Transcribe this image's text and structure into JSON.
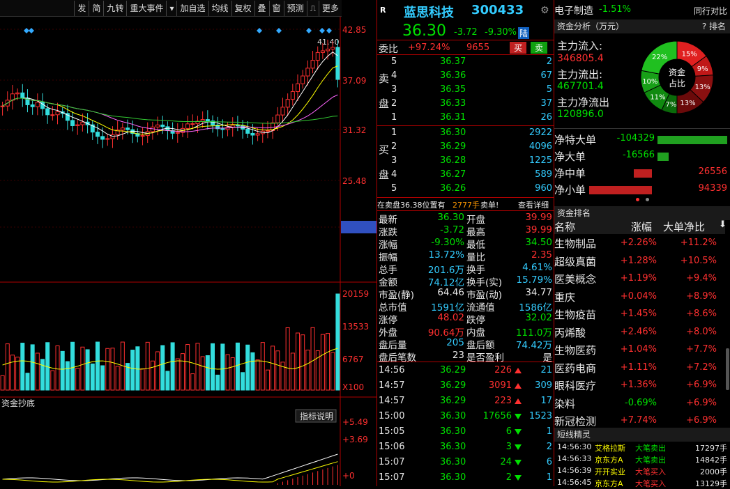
{
  "toolbar": {
    "items": [
      "发",
      "简",
      "九转",
      "重大事件",
      "▾",
      "加自选",
      "均线",
      "复权",
      "叠",
      "窗",
      "预测",
      "⎍",
      "更多"
    ]
  },
  "chart": {
    "price_labels": [
      "42.85",
      "37.09",
      "31.32",
      "25.48",
      "20.04"
    ],
    "peak_label": "41.40",
    "volume_labels": [
      "20159",
      "13533",
      "6767",
      "X100"
    ],
    "indicator_name": "资金抄底",
    "indicator_btn": "指标说明",
    "indicator_labels": [
      "+5.49",
      "+3.69",
      "+0"
    ]
  },
  "stock": {
    "tag": "R",
    "name": "蓝思科技",
    "code": "300433",
    "price": "36.30",
    "change": "-3.72",
    "change_pct": "-9.30%",
    "market": "陆",
    "sector": "电子制造",
    "sector_change": "-1.51%",
    "compare_label": "同行对比"
  },
  "order_ratio": {
    "label": "委比",
    "value": "+97.24%",
    "diff": "9655",
    "sell_btn": "买",
    "buy_btn": "卖"
  },
  "sell_book": [
    {
      "lvl": "5",
      "price": "36.37",
      "vol": "2"
    },
    {
      "lvl": "4",
      "price": "36.36",
      "vol": "67"
    },
    {
      "lvl": "3",
      "price": "36.35",
      "vol": "5"
    },
    {
      "lvl": "2",
      "price": "36.33",
      "vol": "37"
    },
    {
      "lvl": "1",
      "price": "36.31",
      "vol": "26"
    }
  ],
  "buy_book": [
    {
      "lvl": "1",
      "price": "36.30",
      "vol": "2922"
    },
    {
      "lvl": "2",
      "price": "36.29",
      "vol": "4096"
    },
    {
      "lvl": "3",
      "price": "36.28",
      "vol": "1225"
    },
    {
      "lvl": "4",
      "price": "36.27",
      "vol": "589"
    },
    {
      "lvl": "5",
      "price": "36.26",
      "vol": "960"
    }
  ],
  "book_side_labels": {
    "sell1": "卖",
    "sell2": "盘",
    "buy1": "买",
    "buy2": "盘"
  },
  "alert": {
    "text_a": "在卖盘36.38位置有",
    "qty": "2777手",
    "text_b": "卖单!",
    "link": "查看详细"
  },
  "stats": [
    {
      "l1": "最新",
      "v1": "36.30",
      "c1": "grn",
      "l2": "开盘",
      "v2": "39.99",
      "c2": "red"
    },
    {
      "l1": "涨跌",
      "v1": "-3.72",
      "c1": "grn",
      "l2": "最高",
      "v2": "39.99",
      "c2": "red"
    },
    {
      "l1": "涨幅",
      "v1": "-9.30%",
      "c1": "grn",
      "l2": "最低",
      "v2": "34.50",
      "c2": "grn"
    },
    {
      "l1": "振幅",
      "v1": "13.72%",
      "c1": "cyan",
      "l2": "量比",
      "v2": "2.35",
      "c2": "red"
    },
    {
      "l1": "总手",
      "v1": "201.6万",
      "c1": "cyan",
      "l2": "换手",
      "v2": "4.61%",
      "c2": "cyan"
    },
    {
      "l1": "金额",
      "v1": "74.12亿",
      "c1": "cyan",
      "l2": "换手(实)",
      "v2": "15.79%",
      "c2": "cyan"
    },
    {
      "l1": "市盈(静)",
      "v1": "64.46",
      "c1": "wht",
      "l2": "市盈(动)",
      "v2": "34.77",
      "c2": "wht"
    },
    {
      "l1": "总市值",
      "v1": "1591亿",
      "c1": "cyan",
      "l2": "流通值",
      "v2": "1586亿",
      "c2": "cyan"
    },
    {
      "l1": "涨停",
      "v1": "48.02",
      "c1": "red",
      "l2": "跌停",
      "v2": "32.02",
      "c2": "grn"
    },
    {
      "l1": "外盘",
      "v1": "90.64万",
      "c1": "red",
      "l2": "内盘",
      "v2": "111.0万",
      "c2": "grn"
    },
    {
      "l1": "盘后量",
      "v1": "205",
      "c1": "cyan",
      "l2": "盘后额",
      "v2": "74.42万",
      "c2": "cyan"
    },
    {
      "l1": "盘后笔数",
      "v1": "23",
      "c1": "wht",
      "l2": "是否盈利",
      "v2": "是",
      "c2": "wht"
    }
  ],
  "ticks": [
    {
      "t": "14:56",
      "p": "36.29",
      "v": "226",
      "dir": "up",
      "n": "21"
    },
    {
      "t": "14:57",
      "p": "36.29",
      "v": "3091",
      "dir": "up",
      "n": "309"
    },
    {
      "t": "14:57",
      "p": "36.29",
      "v": "223",
      "dir": "up",
      "n": "17"
    },
    {
      "t": "15:00",
      "p": "36.30",
      "v": "17656",
      "dir": "dn",
      "n": "1523"
    },
    {
      "t": "15:05",
      "p": "36.30",
      "v": "6",
      "dir": "dn",
      "n": "1"
    },
    {
      "t": "15:06",
      "p": "36.30",
      "v": "3",
      "dir": "dn",
      "n": "2"
    },
    {
      "t": "15:07",
      "p": "36.30",
      "v": "24",
      "dir": "dn",
      "n": "6"
    },
    {
      "t": "15:07",
      "p": "36.30",
      "v": "2",
      "dir": "dn",
      "n": "1"
    }
  ],
  "capital": {
    "header": "资金分析（万元）",
    "rank_link": "? 排名",
    "inflow_label": "主力流入:",
    "inflow": "346805.4",
    "outflow_label": "主力流出:",
    "outflow": "467701.4",
    "net_label": "主力净流出",
    "net": "120896.0",
    "donut_center_1": "资金",
    "donut_center_2": "占比",
    "donut": [
      {
        "label": "15%",
        "value": 15,
        "color": "#e02020"
      },
      {
        "label": "9%",
        "value": 9,
        "color": "#c01818"
      },
      {
        "label": "13%",
        "value": 13,
        "color": "#8a1010"
      },
      {
        "label": "13%",
        "value": 13,
        "color": "#6a0a0a"
      },
      {
        "label": "7%",
        "value": 7,
        "color": "#0a6a0a"
      },
      {
        "label": "11%",
        "value": 11,
        "color": "#108a10"
      },
      {
        "label": "10%",
        "value": 10,
        "color": "#18a018"
      },
      {
        "label": "22%",
        "value": 22,
        "color": "#20c020"
      }
    ],
    "net_flows": [
      {
        "label": "净特大单",
        "value": "-104329",
        "color": "grn",
        "bar": 1.0
      },
      {
        "label": "净大单",
        "value": "-16566",
        "color": "grn",
        "bar": 0.16
      },
      {
        "label": "净中单",
        "value": "26556",
        "color": "red",
        "bar": 0.26
      },
      {
        "label": "净小单",
        "value": "94339",
        "color": "red",
        "bar": 0.9
      }
    ]
  },
  "ranking": {
    "header": "资金排名",
    "col_name": "名称",
    "col_pct": "涨幅",
    "col_net": "大单净比",
    "rows": [
      {
        "name": "生物制品",
        "pct": "+2.26%",
        "net": "+11.2%"
      },
      {
        "name": "超级真菌",
        "pct": "+1.28%",
        "net": "+10.5%"
      },
      {
        "name": "医美概念",
        "pct": "+1.19%",
        "net": "+9.4%"
      },
      {
        "name": "重庆",
        "pct": "+0.04%",
        "net": "+8.9%"
      },
      {
        "name": "生物疫苗",
        "pct": "+1.45%",
        "net": "+8.6%"
      },
      {
        "name": "丙烯酸",
        "pct": "+2.46%",
        "net": "+8.0%"
      },
      {
        "name": "生物医药",
        "pct": "+1.04%",
        "net": "+7.7%"
      },
      {
        "name": "医药电商",
        "pct": "+1.11%",
        "net": "+7.2%"
      },
      {
        "name": "眼科医疗",
        "pct": "+1.36%",
        "net": "+6.9%"
      },
      {
        "name": "染料",
        "pct": "-0.69%",
        "net": "+6.9%"
      },
      {
        "name": "新冠检测",
        "pct": "+7.74%",
        "net": "+6.9%"
      }
    ]
  },
  "news": {
    "header": "短线精灵",
    "rows": [
      {
        "t": "14:56:30",
        "n": "艾格拉斯",
        "e": "大笔卖出",
        "v": "17297手",
        "c": "grn"
      },
      {
        "t": "14:56:33",
        "n": "京东方A",
        "e": "大笔卖出",
        "v": "14842手",
        "c": "grn"
      },
      {
        "t": "14:56:39",
        "n": "开开实业",
        "e": "大笔买入",
        "v": "2000手",
        "c": "red"
      },
      {
        "t": "14:56:45",
        "n": "京东方A",
        "e": "大笔买入",
        "v": "13129手",
        "c": "red"
      }
    ]
  }
}
